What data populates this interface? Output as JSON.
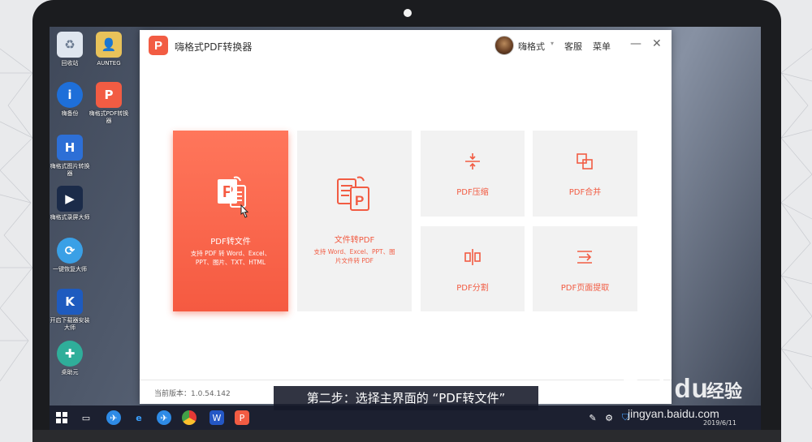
{
  "desktop": {
    "icons": [
      {
        "label": "回收站"
      },
      {
        "label": "AUNTEG"
      },
      {
        "label": "嗨备份"
      },
      {
        "label": "嗨格式PDF转换器"
      },
      {
        "label": "嗨格式图片转换器"
      },
      {
        "label": "嗨格式录屏大师"
      },
      {
        "label": "一键恢复大师"
      },
      {
        "label": "开启下载器安装大师"
      },
      {
        "label": "桌助元"
      }
    ]
  },
  "app": {
    "logo_letter": "P",
    "title": "嗨格式PDF转换器",
    "username": "嗨格式",
    "user_caret": "▾",
    "service": "客服",
    "menu": "菜单",
    "minimize": "—",
    "close": "✕",
    "version": "当前版本：1.0.54.142"
  },
  "tiles": [
    {
      "label": "PDF转文件",
      "desc": "支持 PDF 转 Word、Excel、PPT、图片、TXT、HTML",
      "icon": "pdf-to-file-icon"
    },
    {
      "label": "文件转PDF",
      "desc": "支持 Word、Excel、PPT、图片文件转 PDF",
      "icon": "file-to-pdf-icon"
    },
    {
      "label": "PDF压缩",
      "icon": "compress-icon"
    },
    {
      "label": "PDF合并",
      "icon": "merge-icon"
    },
    {
      "label": "PDF分割",
      "icon": "split-icon"
    },
    {
      "label": "PDF页面提取",
      "icon": "extract-icon"
    }
  ],
  "caption": "第二步：选择主界面的 “PDF转文件”",
  "taskbar": {
    "date": "2019/6/11"
  },
  "watermark": {
    "brand": "Bai du",
    "cn": "经验",
    "url": "jingyan.baidu.com"
  },
  "colors": {
    "accent": "#f25c43",
    "tile_bg": "#f2f2f2"
  }
}
